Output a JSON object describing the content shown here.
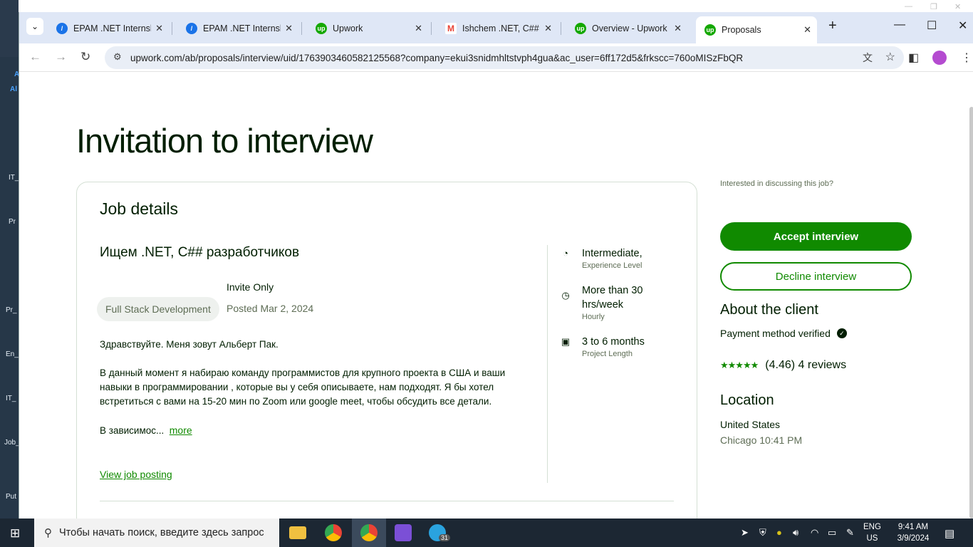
{
  "desktop": {
    "left_labels": [
      "Al",
      "IT_",
      "Pr",
      "Pr_",
      "En_",
      "IT_",
      "Job_",
      "Put"
    ]
  },
  "browser": {
    "tabs": [
      {
        "label": "EPAM .NET Internship",
        "favicon": "slash-icon",
        "color": "#1a73e8"
      },
      {
        "label": "EPAM .NET Internship",
        "favicon": "slash-icon",
        "color": "#1a73e8"
      },
      {
        "label": "Upwork",
        "favicon": "upwork-icon",
        "color": "#14a800"
      },
      {
        "label": "Ishchem .NET, C## ra",
        "favicon": "gmail-icon",
        "color": "#ea4335"
      },
      {
        "label": "Overview - Upwork",
        "favicon": "upwork-icon",
        "color": "#14a800"
      },
      {
        "label": "Proposals",
        "favicon": "upwork-icon",
        "color": "#14a800"
      }
    ],
    "url": "upwork.com/ab/proposals/interview/uid/1763903460582125568?company=ekui3snidmhltstvph4gua&ac_user=6ff172d5&frkscc=760oMISzFbQR"
  },
  "page": {
    "title": "Invitation to interview",
    "job_details": {
      "heading": "Job details",
      "job_title": "Ищем .NET, C## разработчиков",
      "tag": "Full Stack Development",
      "invite": "Invite Only",
      "posted": "Posted Mar 2, 2024",
      "desc_p1": "Здравствуйте. Меня зовут Альберт Пак.",
      "desc_p2": "В данный момент я набираю команду программистов для крупного проекта в США и ваши навыки в программировании , которые вы у себя описываете, нам подходят. Я бы хотел встретиться с вами на 15-20 мин по Zoom или google meet, чтобы обсудить все детали.",
      "desc_p3": "В зависимос...",
      "more": "more",
      "view_posting": "View job posting",
      "features": [
        {
          "value": "Intermediate,",
          "sub": "Experience Level",
          "icon": "brain-icon"
        },
        {
          "value": "More than 30 hrs/week",
          "sub": "Hourly",
          "icon": "clock-icon"
        },
        {
          "value": "3 to 6 months",
          "sub": "Project Length",
          "icon": "calendar-icon"
        }
      ]
    },
    "sidebar": {
      "question": "Interested in discussing this job?",
      "accept": "Accept interview",
      "decline": "Decline interview",
      "about_heading": "About the client",
      "payment": "Payment method verified",
      "rating_text": "(4.46) 4 reviews",
      "rating_value": 4.46,
      "location_heading": "Location",
      "country": "United States",
      "city_time": "Chicago 10:41 PM"
    }
  },
  "taskbar": {
    "search_placeholder": "Чтобы начать поиск, введите здесь запрос",
    "lang1": "ENG",
    "lang2": "US",
    "time": "9:41 AM",
    "date": "3/9/2024",
    "telegram_badge": "31"
  }
}
